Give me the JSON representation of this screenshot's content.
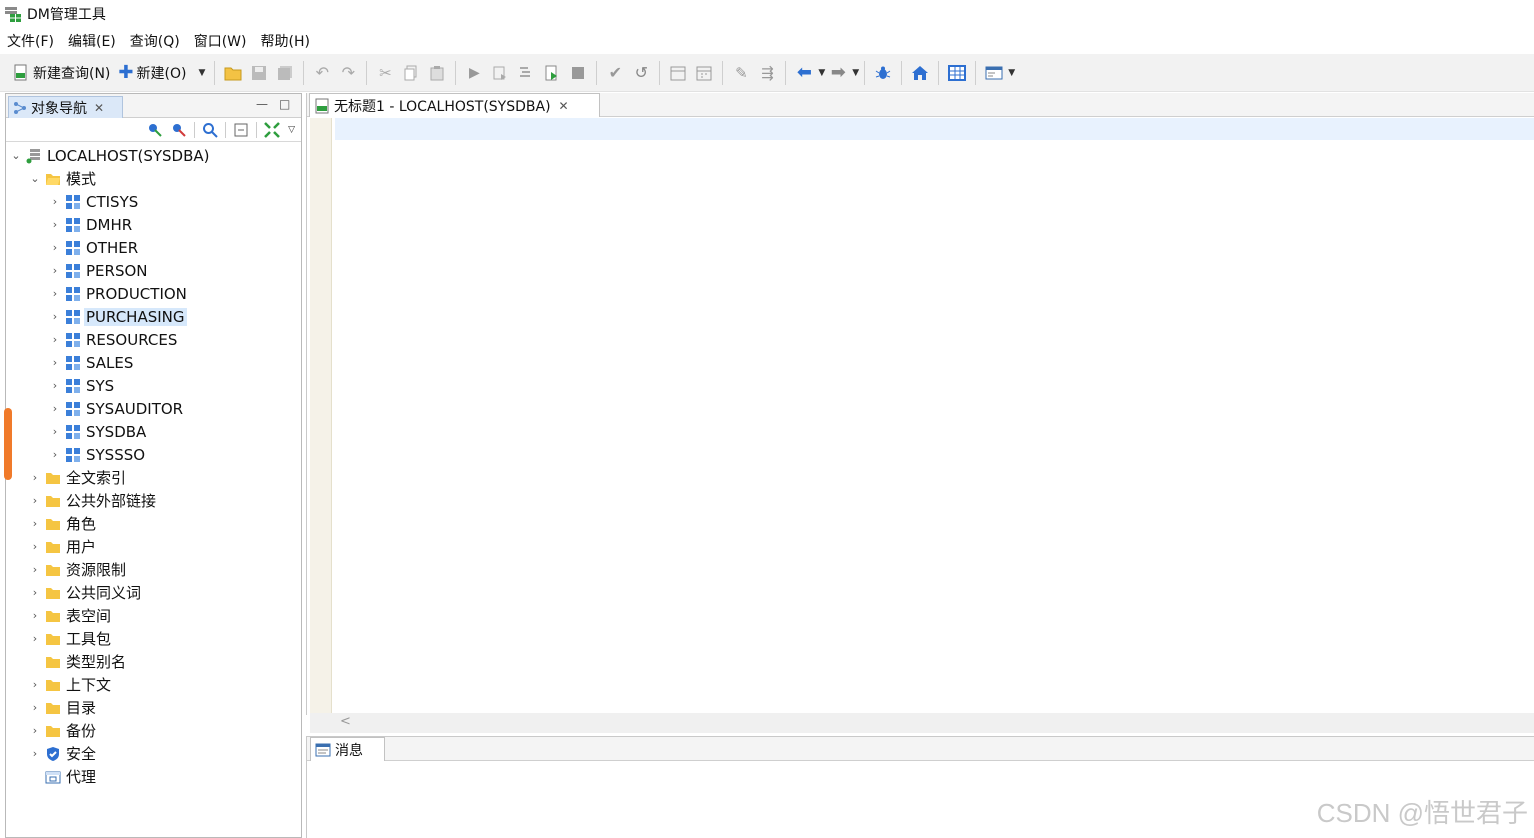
{
  "window": {
    "title": "DM管理工具"
  },
  "menu": [
    "文件(F)",
    "编辑(E)",
    "查询(Q)",
    "窗口(W)",
    "帮助(H)"
  ],
  "toolbar": {
    "new_query": "新建查询(N)",
    "new": "新建(O)"
  },
  "navigator": {
    "tab_label": "对象导航",
    "root": "LOCALHOST(SYSDBA)",
    "schema_folder": "模式",
    "schemas": [
      "CTISYS",
      "DMHR",
      "OTHER",
      "PERSON",
      "PRODUCTION",
      "PURCHASING",
      "RESOURCES",
      "SALES",
      "SYS",
      "SYSAUDITOR",
      "SYSDBA",
      "SYSSSO"
    ],
    "selected_schema": "PURCHASING",
    "folders": [
      "全文索引",
      "公共外部链接",
      "角色",
      "用户",
      "资源限制",
      "公共同义词",
      "表空间",
      "工具包",
      "类型别名",
      "上下文",
      "目录",
      "备份",
      "安全",
      "代理"
    ]
  },
  "editor": {
    "tab_label": "无标题1 - LOCALHOST(SYSDBA)"
  },
  "messages": {
    "tab_label": "消息"
  },
  "watermark": "CSDN @悟世君子",
  "colors": {
    "folder": "#f5c542",
    "schema_blue": "#3b7fd9",
    "selection": "#d6e8fb",
    "toolbar_bg": "#f2f2f2"
  }
}
